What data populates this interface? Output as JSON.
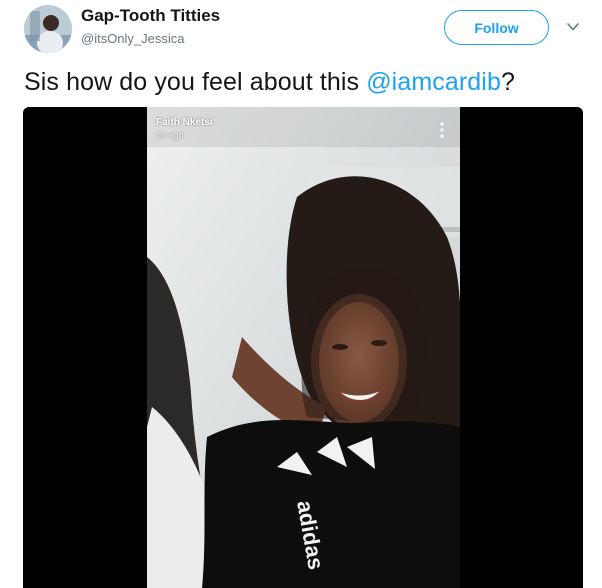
{
  "tweet": {
    "display_name": "Gap-Tooth Titties",
    "handle": "@itsOnly_Jessica",
    "follow_label": "Follow",
    "text_prefix": "Sis how do you feel about this ",
    "mention": "@iamcardib",
    "text_suffix": "?"
  },
  "icons": {
    "caret": "chevron-down-icon",
    "story_menu": "more-vertical-icon"
  },
  "media": {
    "story_user": "Faith Nketsi",
    "story_time": "6h ago"
  },
  "colors": {
    "accent": "#1da1f2",
    "name": "#14171a",
    "secondary": "#657786"
  }
}
